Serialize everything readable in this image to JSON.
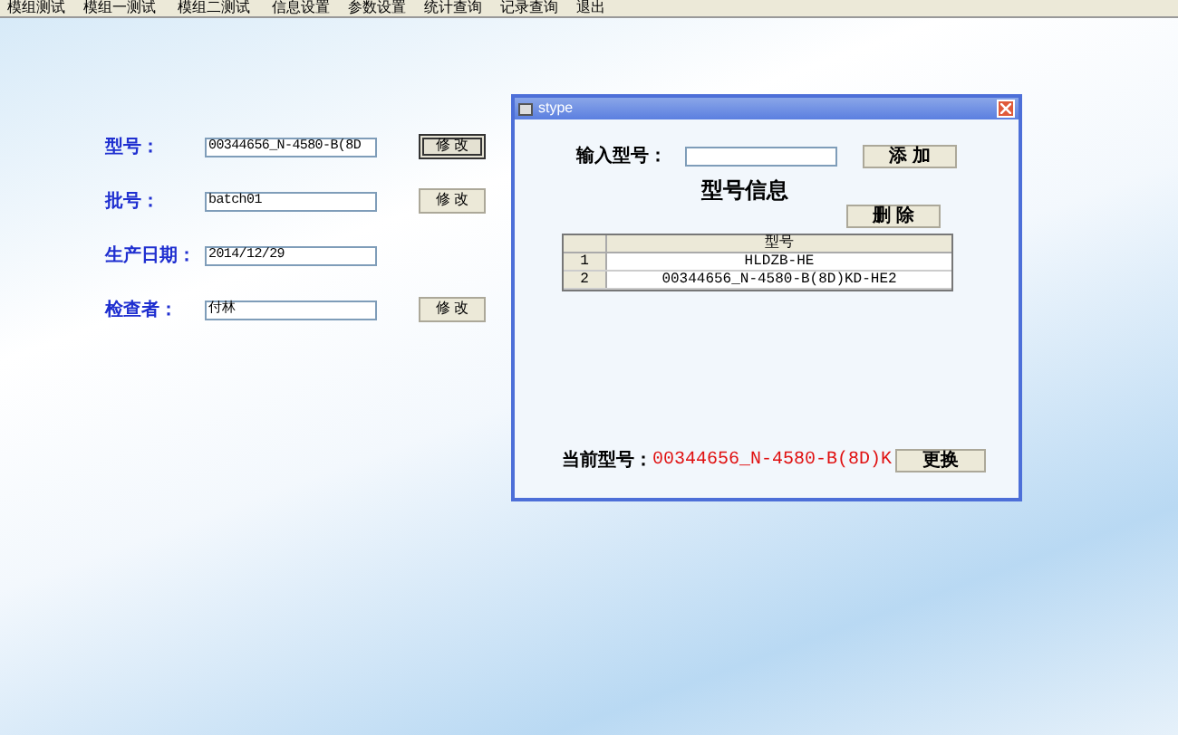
{
  "menu": [
    "模组测试",
    "模组一测试",
    "模组二测试",
    "信息设置",
    "参数设置",
    "统计查询",
    "记录查询",
    "退出"
  ],
  "form": {
    "rows": [
      {
        "label": "型号：",
        "value": "00344656_N-4580-B(8D",
        "button": "修 改",
        "focused": true
      },
      {
        "label": "批号：",
        "value": "batch01",
        "button": "修 改",
        "focused": false
      },
      {
        "label": "生产日期：",
        "value": "2014/12/29"
      },
      {
        "label": "检查者：",
        "value": "付林",
        "button": "修 改",
        "focused": false
      }
    ]
  },
  "dialog": {
    "title": "stype",
    "input_label": "输入型号：",
    "add_button": "添 加",
    "heading": "型号信息",
    "delete_button": "删 除",
    "table": {
      "columns": [
        "型号"
      ],
      "rows": [
        {
          "index": "1",
          "cells": [
            "HLDZB-HE"
          ]
        },
        {
          "index": "2",
          "cells": [
            "00344656_N-4580-B(8D)KD-HE2"
          ]
        }
      ]
    },
    "current_label": "当前型号：",
    "current_value": "00344656_N-4580-B(8D)K",
    "change_button": "更换"
  }
}
